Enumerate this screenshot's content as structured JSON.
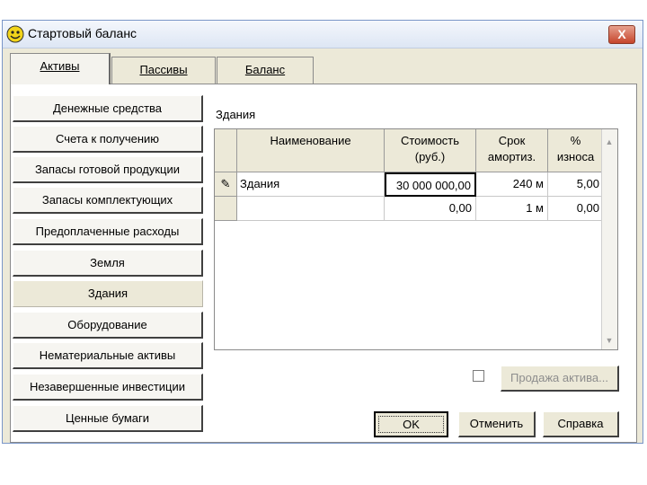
{
  "window": {
    "title": "Стартовый баланс",
    "close_label": "X"
  },
  "tabs": [
    {
      "label": "Активы",
      "active": true
    },
    {
      "label": "Пассивы",
      "active": false
    },
    {
      "label": "Баланс",
      "active": false
    }
  ],
  "categories": [
    {
      "label": "Денежные средства",
      "selected": false
    },
    {
      "label": "Счета к получению",
      "selected": false
    },
    {
      "label": "Запасы готовой продукции",
      "selected": false
    },
    {
      "label": "Запасы комплектующих",
      "selected": false
    },
    {
      "label": "Предоплаченные расходы",
      "selected": false
    },
    {
      "label": "Земля",
      "selected": false
    },
    {
      "label": "Здания",
      "selected": true
    },
    {
      "label": "Оборудование",
      "selected": false
    },
    {
      "label": "Нематериальные активы",
      "selected": false
    },
    {
      "label": "Незавершенные инвестиции",
      "selected": false
    },
    {
      "label": "Ценные бумаги",
      "selected": false
    }
  ],
  "group_label": "Здания",
  "grid": {
    "columns": [
      "Наименование",
      "Стоимость (руб.)",
      "Срок амортиз.",
      "% износа"
    ],
    "rows": [
      {
        "indicator": "✎",
        "name": "Здания",
        "cost": "30 000 000,00",
        "term": "240 м",
        "wear": "5,00"
      },
      {
        "indicator": "",
        "name": "",
        "cost": "0,00",
        "term": "1 м",
        "wear": "0,00"
      }
    ]
  },
  "sell_asset_label": "Продажа актива...",
  "buttons": {
    "ok": "OK",
    "cancel": "Отменить",
    "help": "Справка"
  },
  "colors": {
    "face": "#ece9d8",
    "title_gradient_top": "#f4f7fc",
    "close": "#c6452b"
  }
}
